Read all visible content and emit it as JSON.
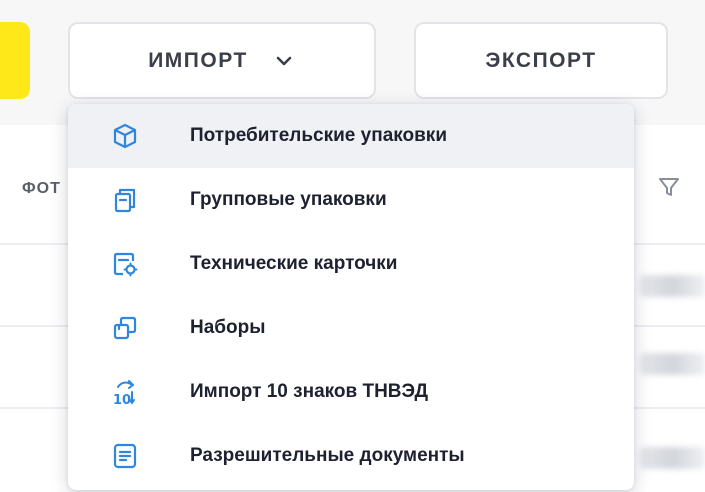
{
  "toolbar": {
    "import_label": "ИМПОРТ",
    "export_label": "ЭКСПОРТ"
  },
  "table": {
    "column_header_partial": "ФОТ"
  },
  "import_menu": {
    "items": [
      {
        "label": "Потребительские упаковки",
        "icon": "cube-icon"
      },
      {
        "label": "Групповые упаковки",
        "icon": "group-pack-icon"
      },
      {
        "label": "Технические карточки",
        "icon": "tech-card-icon"
      },
      {
        "label": "Наборы",
        "icon": "sets-icon"
      },
      {
        "label": "Импорт 10 знаков ТНВЭД",
        "icon": "import-10-icon"
      },
      {
        "label": "Разрешительные документы",
        "icon": "document-icon"
      }
    ]
  },
  "colors": {
    "accent_yellow": "#ffe81a",
    "icon_blue": "#2f86de",
    "active_row": "#f0f1f4"
  }
}
